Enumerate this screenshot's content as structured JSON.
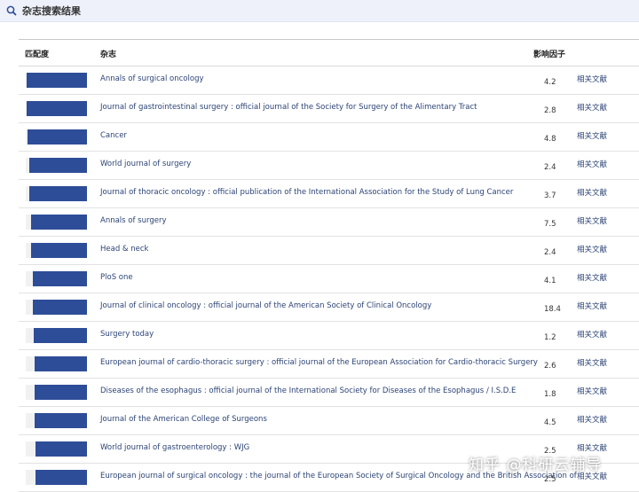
{
  "header": {
    "title": "杂志搜索结果",
    "icon": "search-icon"
  },
  "columns": {
    "match": "匹配度",
    "journal": "杂志",
    "impact": "影响因子"
  },
  "related_label": "相关文献",
  "rows": [
    {
      "journal": "Annals of surgical oncology",
      "impact_factor": "4.2",
      "match": 0.99
    },
    {
      "journal": "Journal of gastrointestinal surgery : official journal of the Society for Surgery of the Alimentary Tract",
      "impact_factor": "2.8",
      "match": 0.99
    },
    {
      "journal": "Cancer",
      "impact_factor": "4.8",
      "match": 0.97
    },
    {
      "journal": "World journal of surgery",
      "impact_factor": "2.4",
      "match": 0.95
    },
    {
      "journal": "Journal of thoracic oncology : official publication of the International Association for the Study of Lung Cancer",
      "impact_factor": "3.7",
      "match": 0.94
    },
    {
      "journal": "Annals of surgery",
      "impact_factor": "7.5",
      "match": 0.92
    },
    {
      "journal": "Head & neck",
      "impact_factor": "2.4",
      "match": 0.91
    },
    {
      "journal": "PloS one",
      "impact_factor": "4.1",
      "match": 0.89
    },
    {
      "journal": "Journal of clinical oncology : official journal of the American Society of Clinical Oncology",
      "impact_factor": "18.4",
      "match": 0.88
    },
    {
      "journal": "Surgery today",
      "impact_factor": "1.2",
      "match": 0.87
    },
    {
      "journal": "European journal of cardio-thoracic surgery : official journal of the European Association for Cardio-thoracic Surgery",
      "impact_factor": "2.6",
      "match": 0.86
    },
    {
      "journal": "Diseases of the esophagus : official journal of the International Society for Diseases of the Esophagus / I.S.D.E",
      "impact_factor": "1.8",
      "match": 0.85
    },
    {
      "journal": "Journal of the American College of Surgeons",
      "impact_factor": "4.5",
      "match": 0.85
    },
    {
      "journal": "World journal of gastroenterology : WJG",
      "impact_factor": "2.5",
      "match": 0.84
    },
    {
      "journal": "European journal of surgical oncology : the journal of the European Society of Surgical Oncology and the British Association of",
      "impact_factor": "2.5",
      "match": 0.84
    }
  ],
  "watermark": "知乎 @科研云辅导"
}
